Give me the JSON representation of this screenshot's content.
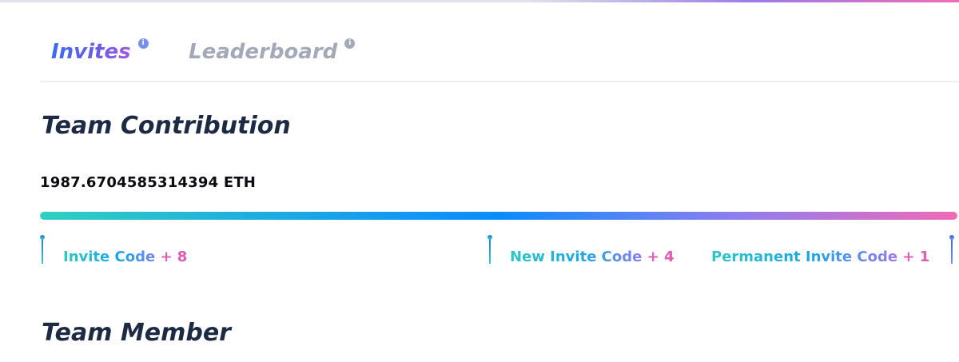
{
  "tabs": {
    "invites": {
      "label": "Invites",
      "info_icon": "info-icon"
    },
    "leaderboard": {
      "label": "Leaderboard",
      "info_icon": "info-icon"
    },
    "active": "Invites"
  },
  "team_contribution": {
    "title": "Team Contribution",
    "value": "1987.6704585314394 ETH",
    "progress": 1.0
  },
  "milestones": [
    {
      "label": "Invite Code",
      "bonus": "+ 8"
    },
    {
      "label": "New Invite Code",
      "bonus": "+ 4"
    },
    {
      "label": "Permanent Invite Code",
      "bonus": "+ 1"
    }
  ],
  "team_member": {
    "title": "Team Member"
  },
  "colors": {
    "accent_start": "#2fd0c0",
    "accent_mid": "#0a8cff",
    "accent_end": "#f06bb7",
    "title_text": "#1d2a44",
    "inactive_tab": "#a3a9b6"
  }
}
